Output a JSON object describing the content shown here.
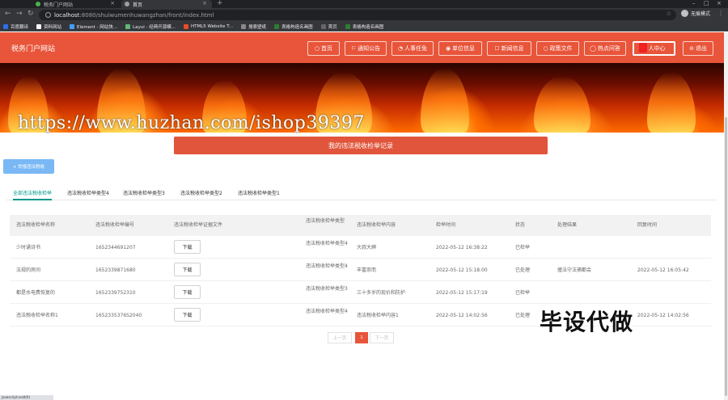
{
  "browser": {
    "tabs": [
      {
        "title": "税务门户网站"
      },
      {
        "title": "首页"
      }
    ],
    "url_host": "localhost",
    "url_path": ":8080/shuiwumenhuwangzhan/front/index.html",
    "profile_label": "无痕模式",
    "bookmarks": [
      {
        "label": "百度翻译",
        "color": "#2e6fe8"
      },
      {
        "label": "资料网站",
        "color": "#f5f5f5"
      },
      {
        "label": "Element - 网站快...",
        "color": "#409eff"
      },
      {
        "label": "Layui - 经典开源模...",
        "color": "#5fb878"
      },
      {
        "label": "HTML5 Website T...",
        "color": "#e44d26"
      },
      {
        "label": "搜索壁纸",
        "color": "#888888"
      },
      {
        "label": "表格构造名画图",
        "color": "#2e7d32"
      },
      {
        "label": "首页",
        "color": "#666666"
      },
      {
        "label": "表格构造名画图",
        "color": "#2e7d32"
      }
    ]
  },
  "site": {
    "title": "税务门户网站",
    "nav": [
      {
        "icon": "○",
        "label": "首页"
      },
      {
        "icon": "⚐",
        "label": "通知公告"
      },
      {
        "icon": "◔",
        "label": "人事任免"
      },
      {
        "icon": "◉",
        "label": "单位信息"
      },
      {
        "icon": "☐",
        "label": "新闻信息"
      },
      {
        "icon": "○",
        "label": "政策文件"
      },
      {
        "icon": "◯",
        "label": "热点问答"
      },
      {
        "icon": "♀",
        "label": "人中心"
      },
      {
        "icon": "⊖",
        "label": "退出"
      }
    ]
  },
  "watermarks": {
    "url": "https://www.huzhan.com/ishop39397",
    "cn": "毕设代做"
  },
  "page": {
    "title": "我的违法税收检举记录",
    "add_button": "+ 举报违法税收"
  },
  "type_tabs": [
    "全部违法税收检举",
    "违法税收检举类型4",
    "违法税收检举类型3",
    "违法税收检举类型2",
    "违法税收检举类型1"
  ],
  "table": {
    "headers": [
      "违法税收检举名称",
      "违法税收检举编号",
      "违法税收检举证据文件",
      "违法税收检举类型",
      "违法税收检举内容",
      "检举时间",
      "状态",
      "处理结果",
      "回复时间"
    ],
    "rows": [
      {
        "name": "少时诵诗书",
        "code": "1652344691207",
        "file": "下载",
        "type": "违法税收检举类型4",
        "content": "大叔大婶",
        "time": "2022-05-12 16:38:22",
        "status": "已检举",
        "result": "",
        "reply": ""
      },
      {
        "name": "法规的房间",
        "code": "1652339871680",
        "file": "下载",
        "type": "违法税收检举类型4",
        "content": "丰富崇而",
        "time": "2022-05-12 15:18:00",
        "status": "已处理",
        "result": "撞法守法捕都会",
        "reply": "2022-05-12 16:05:42"
      },
      {
        "name": "都是水电费恢复的",
        "code": "1652339752310",
        "file": "下载",
        "type": "违法税收检举类型3",
        "content": "三十多岁的现价和防护",
        "time": "2022-05-12 15:17:19",
        "status": "已检举",
        "result": "",
        "reply": ""
      },
      {
        "name": "违法税收检举名称1",
        "code": "1652335376S2040",
        "file": "下载",
        "type": "违法税收检举类型4",
        "content": "违法税收检举内容1",
        "time": "2022-05-12 14:02:56",
        "status": "已处理",
        "result": "",
        "reply": "2022-05-12 14:02:56"
      }
    ]
  },
  "pager": {
    "prev": "上一页",
    "current": "1",
    "next": "下一页"
  },
  "status_text": "javascript:void(0)"
}
